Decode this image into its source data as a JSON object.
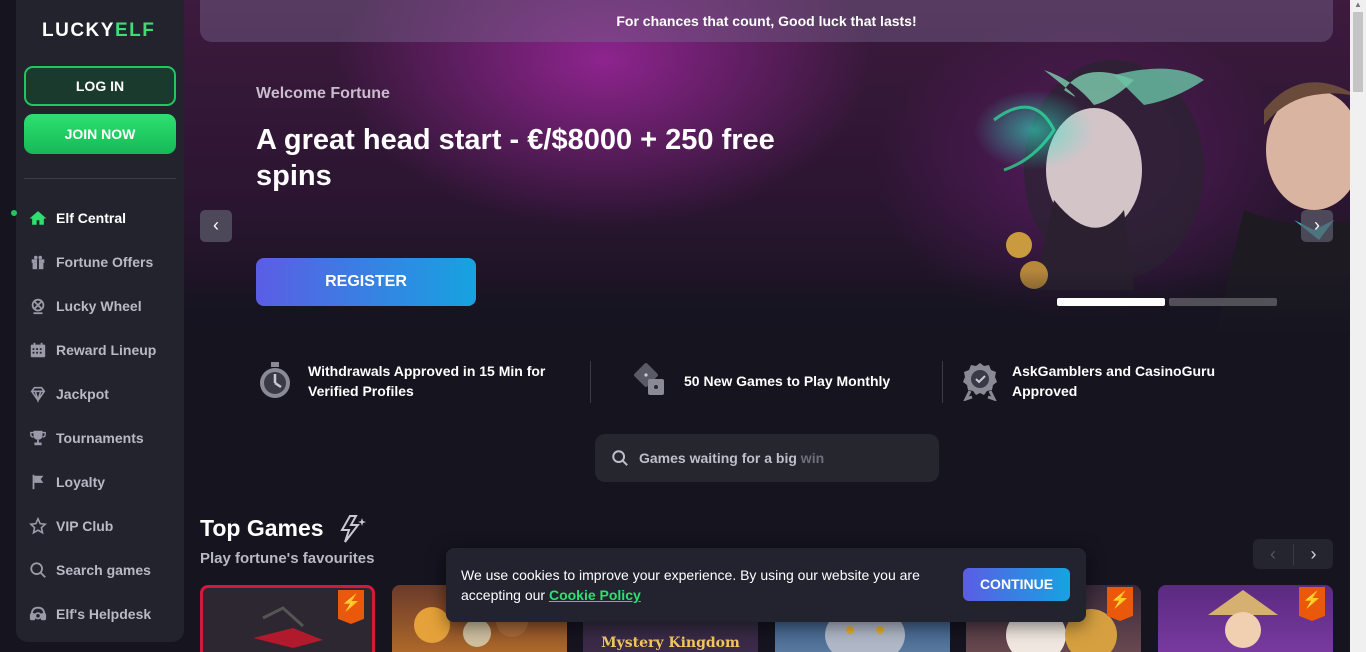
{
  "brand": {
    "name_prefix": "LUCKY",
    "name_suffix": "ELF"
  },
  "auth": {
    "login_label": "LOG IN",
    "join_label": "JOIN NOW"
  },
  "nav": {
    "items": [
      {
        "label": "Elf Central",
        "icon": "home-icon",
        "active": true
      },
      {
        "label": "Fortune Offers",
        "icon": "gift-icon"
      },
      {
        "label": "Lucky Wheel",
        "icon": "wheel-icon"
      },
      {
        "label": "Reward Lineup",
        "icon": "calendar-icon"
      },
      {
        "label": "Jackpot",
        "icon": "diamond-icon"
      },
      {
        "label": "Tournaments",
        "icon": "trophy-icon"
      },
      {
        "label": "Loyalty",
        "icon": "flag-icon"
      },
      {
        "label": "VIP Club",
        "icon": "star-icon"
      },
      {
        "label": "Search games",
        "icon": "search-icon"
      },
      {
        "label": "Elf's Helpdesk",
        "icon": "helpdesk-icon"
      }
    ]
  },
  "banner": {
    "text": "For chances that count, Good luck that lasts!"
  },
  "hero": {
    "subtitle": "Welcome Fortune",
    "title": "A great head start - €/$8000 + 250 free spins",
    "register_label": "REGISTER",
    "prev_arrow": "‹",
    "next_arrow": "›",
    "slides_total": 2,
    "active_slide": 1
  },
  "features": [
    {
      "text": "Withdrawals Approved in 15 Min for Verified Profiles",
      "icon": "stopwatch-icon"
    },
    {
      "text": "50 New Games to Play Monthly",
      "icon": "dice-icon"
    },
    {
      "text": "AskGamblers and CasinoGuru Approved",
      "icon": "badge-icon"
    }
  ],
  "search": {
    "placeholder_main": "Games waiting for a big",
    "placeholder_dim": " win"
  },
  "top_games": {
    "title": "Top Games",
    "subtitle": "Play fortune's favourites",
    "prev": "‹",
    "next": "›",
    "hot_badge": "⚡",
    "tile_label_3": "Mystery Kingdom"
  },
  "cookie": {
    "text_before": "We use cookies to improve your experience. By using our website you are accepting our ",
    "link_text": "Cookie Policy",
    "continue_label": "CONTINUE"
  },
  "colors": {
    "accent_green": "#22c55e",
    "accent_blue": "#16a3e0",
    "accent_purple": "#5b5de5",
    "background": "#15141f"
  }
}
